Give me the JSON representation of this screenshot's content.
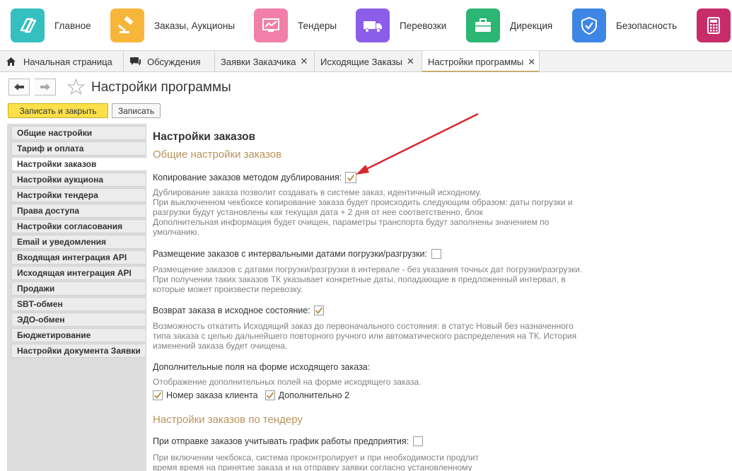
{
  "sections": [
    {
      "label": "Главное",
      "icon": "main-logo-icon",
      "color": "#35bfbf"
    },
    {
      "label": "Заказы, Аукционы",
      "icon": "auction-hammer-icon",
      "color": "#f7b63a"
    },
    {
      "label": "Тендеры",
      "icon": "chart-monitor-icon",
      "color": "#f27fa7"
    },
    {
      "label": "Перевозки",
      "icon": "truck-icon",
      "color": "#8b5de8"
    },
    {
      "label": "Дирекция",
      "icon": "briefcase-icon",
      "color": "#2bb673"
    },
    {
      "label": "Безопасность",
      "icon": "shield-check-icon",
      "color": "#3e86e6"
    },
    {
      "label": "",
      "icon": "calculator-icon",
      "color": "#c72d6a"
    }
  ],
  "tabs": [
    {
      "label": "Начальная страница",
      "icon": "home-icon",
      "closable": false
    },
    {
      "label": "Обсуждения",
      "icon": "comments-icon",
      "closable": false
    },
    {
      "label": "Заявки Заказчика",
      "closable": true
    },
    {
      "label": "Исходящие Заказы",
      "closable": true
    },
    {
      "label": "Настройки программы",
      "closable": true,
      "active": true
    }
  ],
  "page": {
    "title": "Настройки программы",
    "save_close_label": "Записать и закрыть",
    "save_label": "Записать"
  },
  "nav": [
    "Общие настройки",
    "Тариф и оплата",
    "Настройки заказов",
    "Настройки аукциона",
    "Настройки тендера",
    "Права доступа",
    "Настройки согласования",
    "Email и уведомления",
    "Входящая интеграция API",
    "Исходящая интеграция API",
    "Продажи",
    "SBT-обмен",
    "ЭДО-обмен",
    "Бюджетирование",
    "Настройки документа Заявки"
  ],
  "nav_active_index": 2,
  "content": {
    "heading": "Настройки заказов",
    "group1_title": "Общие настройки заказов",
    "s1_label": "Копирование заказов методом дублирования:",
    "s1_checked": true,
    "s1_desc": [
      "Дублирование заказа позволит создавать в системе заказ, идентичный исходному.",
      "При выключенном чекбоксе копирование заказа будет происходить следующим образом: даты погрузки и",
      "разгрузки будут установлены как текущая дата + 2 дня от нее соответственно, блок",
      "Дополнительная информация будет очищен, параметры транспорта будут заполнены значением по",
      "умолчанию."
    ],
    "s2_label": "Размещение заказов с интервальными датами погрузки/разгрузки:",
    "s2_checked": false,
    "s2_desc": [
      "Размещение заказов с датами погрузки/разгрузки в интервале - без указания точных дат погрузки/разгрузки.",
      "При получении таких заказов ТК указывает конкретные даты, попадающие в предложенный интервал, в",
      "которые может произвести перевозку."
    ],
    "s3_label": "Возврат заказа в исходное состояние:",
    "s3_checked": true,
    "s3_desc": [
      "Возможность откатить Исходящий заказ до первоначального состояния: в статус Новый без назначенного",
      "типа заказа с целью дальнейшего повторного ручного или автоматического распределения на ТК. История",
      "изменений заказа будет очищена."
    ],
    "s4_label": "Дополнительные поля на форме исходящего заказа:",
    "s4_desc": "Отображение дополнительных полей на форме исходящего заказа.",
    "s4_opt1": "Номер заказа клиента",
    "s4_opt2": "Дополнительно 2",
    "group2_title": "Настройки заказов по тендеру",
    "s5_label": "При отправке заказов учитывать график работы предприятия:",
    "s5_checked": false,
    "s5_desc": [
      "При включении чекбокса, система проконтролирует и при необходимости продлит",
      "время время на принятие заказа и на отправку заявки согласно установленному"
    ]
  },
  "colors": {
    "accent_gold": "#b8925a",
    "primary_button": "#fbe04a",
    "annotation_arrow": "#d9262b"
  }
}
